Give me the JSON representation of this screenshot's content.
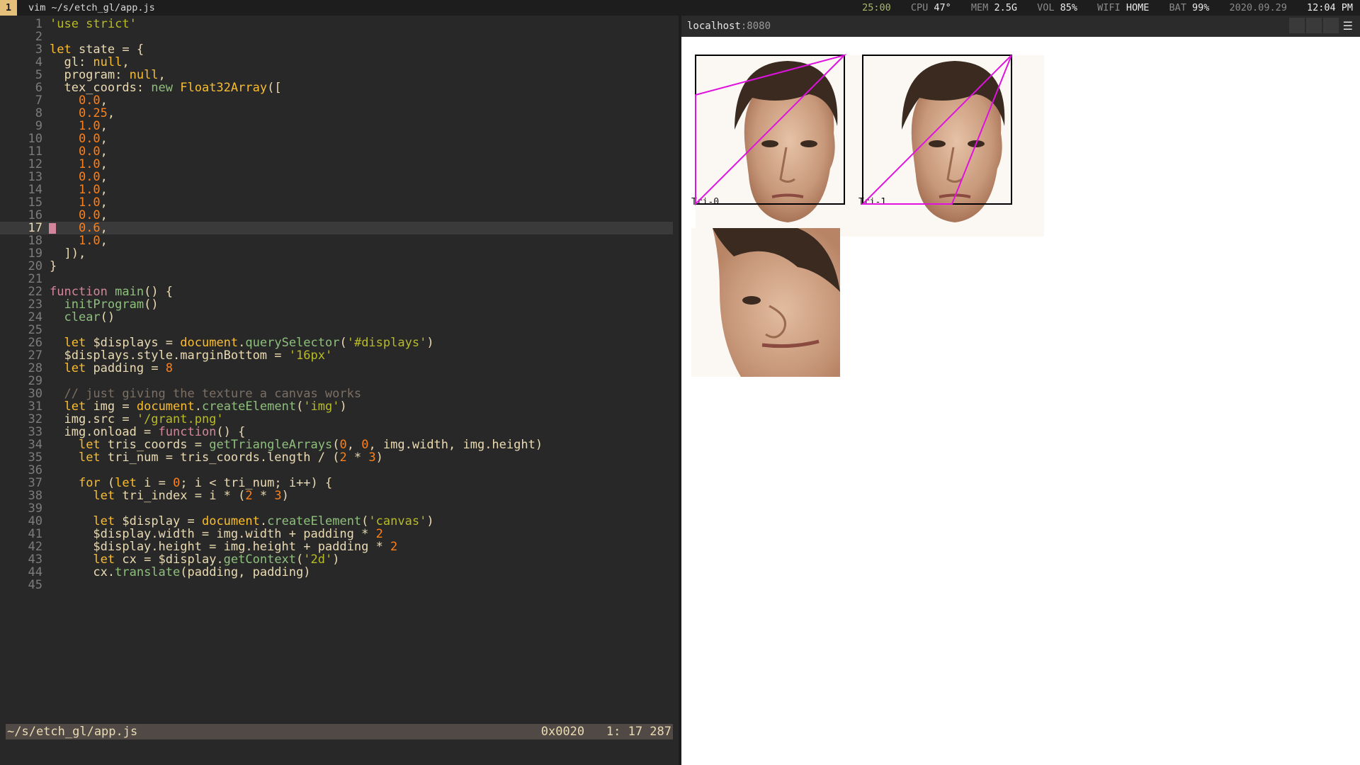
{
  "topbar": {
    "workspace": "1",
    "window_title": "vim ~/s/etch_gl/app.js",
    "timer": "25:00",
    "cpu_label": "CPU",
    "cpu_value": "47°",
    "mem_label": "MEM",
    "mem_value": "2.5G",
    "vol_label": "VOL",
    "vol_value": "85%",
    "wifi_label": "WIFI",
    "wifi_value": "HOME",
    "bat_label": "BAT",
    "bat_value": "99%",
    "date": "2020.09.29",
    "time": "12:04 PM"
  },
  "editor": {
    "current_line": 17,
    "lines": [
      {
        "n": "1",
        "tokens": [
          [
            "s",
            "'use strict'"
          ]
        ]
      },
      {
        "n": "2",
        "tokens": []
      },
      {
        "n": "3",
        "tokens": [
          [
            "k",
            "let"
          ],
          [
            "p",
            " state = {"
          ]
        ]
      },
      {
        "n": "4",
        "tokens": [
          [
            "p",
            "  gl: "
          ],
          [
            "l",
            "null"
          ],
          [
            "p",
            ","
          ]
        ]
      },
      {
        "n": "5",
        "tokens": [
          [
            "p",
            "  program: "
          ],
          [
            "l",
            "null"
          ],
          [
            "p",
            ","
          ]
        ]
      },
      {
        "n": "6",
        "tokens": [
          [
            "p",
            "  tex_coords: "
          ],
          [
            "f",
            "new "
          ],
          [
            "k",
            "Float32Array"
          ],
          [
            "p",
            "(["
          ]
        ]
      },
      {
        "n": "7",
        "tokens": [
          [
            "p",
            "    "
          ],
          [
            "n",
            "0.0"
          ],
          [
            "p",
            ","
          ]
        ]
      },
      {
        "n": "8",
        "tokens": [
          [
            "p",
            "    "
          ],
          [
            "n",
            "0.25"
          ],
          [
            "p",
            ","
          ]
        ]
      },
      {
        "n": "9",
        "tokens": [
          [
            "p",
            "    "
          ],
          [
            "n",
            "1.0"
          ],
          [
            "p",
            ","
          ]
        ]
      },
      {
        "n": "10",
        "tokens": [
          [
            "p",
            "    "
          ],
          [
            "n",
            "0.0"
          ],
          [
            "p",
            ","
          ]
        ]
      },
      {
        "n": "11",
        "tokens": [
          [
            "p",
            "    "
          ],
          [
            "n",
            "0.0"
          ],
          [
            "p",
            ","
          ]
        ]
      },
      {
        "n": "12",
        "tokens": [
          [
            "p",
            "    "
          ],
          [
            "n",
            "1.0"
          ],
          [
            "p",
            ","
          ]
        ]
      },
      {
        "n": "13",
        "tokens": [
          [
            "p",
            "    "
          ],
          [
            "n",
            "0.0"
          ],
          [
            "p",
            ","
          ]
        ]
      },
      {
        "n": "14",
        "tokens": [
          [
            "p",
            "    "
          ],
          [
            "n",
            "1.0"
          ],
          [
            "p",
            ","
          ]
        ]
      },
      {
        "n": "15",
        "tokens": [
          [
            "p",
            "    "
          ],
          [
            "n",
            "1.0"
          ],
          [
            "p",
            ","
          ]
        ]
      },
      {
        "n": "16",
        "tokens": [
          [
            "p",
            "    "
          ],
          [
            "n",
            "0.0"
          ],
          [
            "p",
            ","
          ]
        ]
      },
      {
        "n": "17",
        "tokens": [
          [
            "p",
            "    "
          ],
          [
            "n",
            "0.6"
          ],
          [
            "p",
            ","
          ]
        ]
      },
      {
        "n": "18",
        "tokens": [
          [
            "p",
            "    "
          ],
          [
            "n",
            "1.0"
          ],
          [
            "p",
            ","
          ]
        ]
      },
      {
        "n": "19",
        "tokens": [
          [
            "p",
            "  ]),"
          ]
        ]
      },
      {
        "n": "20",
        "tokens": [
          [
            "p",
            "}"
          ]
        ]
      },
      {
        "n": "21",
        "tokens": []
      },
      {
        "n": "22",
        "tokens": [
          [
            "m",
            "function "
          ],
          [
            "f",
            "main"
          ],
          [
            "p",
            "() {"
          ]
        ]
      },
      {
        "n": "23",
        "tokens": [
          [
            "p",
            "  "
          ],
          [
            "f",
            "initProgram"
          ],
          [
            "p",
            "()"
          ]
        ]
      },
      {
        "n": "24",
        "tokens": [
          [
            "p",
            "  "
          ],
          [
            "f",
            "clear"
          ],
          [
            "p",
            "()"
          ]
        ]
      },
      {
        "n": "25",
        "tokens": []
      },
      {
        "n": "26",
        "tokens": [
          [
            "p",
            "  "
          ],
          [
            "k",
            "let"
          ],
          [
            "p",
            " $displays = "
          ],
          [
            "k",
            "document"
          ],
          [
            "p",
            "."
          ],
          [
            "f",
            "querySelector"
          ],
          [
            "p",
            "("
          ],
          [
            "s",
            "'#displays'"
          ],
          [
            "p",
            ")"
          ]
        ]
      },
      {
        "n": "27",
        "tokens": [
          [
            "p",
            "  $displays.style.marginBottom = "
          ],
          [
            "s",
            "'16px'"
          ]
        ]
      },
      {
        "n": "28",
        "tokens": [
          [
            "p",
            "  "
          ],
          [
            "k",
            "let"
          ],
          [
            "p",
            " padding = "
          ],
          [
            "n",
            "8"
          ]
        ]
      },
      {
        "n": "29",
        "tokens": []
      },
      {
        "n": "30",
        "tokens": [
          [
            "c",
            "  // just giving the texture a canvas works"
          ]
        ]
      },
      {
        "n": "31",
        "tokens": [
          [
            "p",
            "  "
          ],
          [
            "k",
            "let"
          ],
          [
            "p",
            " img = "
          ],
          [
            "k",
            "document"
          ],
          [
            "p",
            "."
          ],
          [
            "f",
            "createElement"
          ],
          [
            "p",
            "("
          ],
          [
            "s",
            "'img'"
          ],
          [
            "p",
            ")"
          ]
        ]
      },
      {
        "n": "32",
        "tokens": [
          [
            "p",
            "  img.src = "
          ],
          [
            "s",
            "'/grant.png'"
          ]
        ]
      },
      {
        "n": "33",
        "tokens": [
          [
            "p",
            "  img.onload = "
          ],
          [
            "m",
            "function"
          ],
          [
            "p",
            "() {"
          ]
        ]
      },
      {
        "n": "34",
        "tokens": [
          [
            "p",
            "    "
          ],
          [
            "k",
            "let"
          ],
          [
            "p",
            " tris_coords = "
          ],
          [
            "f",
            "getTriangleArrays"
          ],
          [
            "p",
            "("
          ],
          [
            "n",
            "0"
          ],
          [
            "p",
            ", "
          ],
          [
            "n",
            "0"
          ],
          [
            "p",
            ", img.width, img.height)"
          ]
        ]
      },
      {
        "n": "35",
        "tokens": [
          [
            "p",
            "    "
          ],
          [
            "k",
            "let"
          ],
          [
            "p",
            " tri_num = tris_coords.length / ("
          ],
          [
            "n",
            "2"
          ],
          [
            "p",
            " * "
          ],
          [
            "n",
            "3"
          ],
          [
            "p",
            ")"
          ]
        ]
      },
      {
        "n": "36",
        "tokens": []
      },
      {
        "n": "37",
        "tokens": [
          [
            "p",
            "    "
          ],
          [
            "k",
            "for"
          ],
          [
            "p",
            " ("
          ],
          [
            "k",
            "let"
          ],
          [
            "p",
            " i = "
          ],
          [
            "n",
            "0"
          ],
          [
            "p",
            "; i < tri_num; i++) {"
          ]
        ]
      },
      {
        "n": "38",
        "tokens": [
          [
            "p",
            "      "
          ],
          [
            "k",
            "let"
          ],
          [
            "p",
            " tri_index = i * ("
          ],
          [
            "n",
            "2"
          ],
          [
            "p",
            " * "
          ],
          [
            "n",
            "3"
          ],
          [
            "p",
            ")"
          ]
        ]
      },
      {
        "n": "39",
        "tokens": []
      },
      {
        "n": "40",
        "tokens": [
          [
            "p",
            "      "
          ],
          [
            "k",
            "let"
          ],
          [
            "p",
            " $display = "
          ],
          [
            "k",
            "document"
          ],
          [
            "p",
            "."
          ],
          [
            "f",
            "createElement"
          ],
          [
            "p",
            "("
          ],
          [
            "s",
            "'canvas'"
          ],
          [
            "p",
            ")"
          ]
        ]
      },
      {
        "n": "41",
        "tokens": [
          [
            "p",
            "      $display.width = img.width + padding * "
          ],
          [
            "n",
            "2"
          ]
        ]
      },
      {
        "n": "42",
        "tokens": [
          [
            "p",
            "      $display.height = img.height + padding * "
          ],
          [
            "n",
            "2"
          ]
        ]
      },
      {
        "n": "43",
        "tokens": [
          [
            "p",
            "      "
          ],
          [
            "k",
            "let"
          ],
          [
            "p",
            " cx = $display."
          ],
          [
            "f",
            "getContext"
          ],
          [
            "p",
            "("
          ],
          [
            "s",
            "'2d'"
          ],
          [
            "p",
            ")"
          ]
        ]
      },
      {
        "n": "44",
        "tokens": [
          [
            "p",
            "      cx."
          ],
          [
            "f",
            "translate"
          ],
          [
            "p",
            "(padding, padding)"
          ]
        ]
      },
      {
        "n": "45",
        "tokens": []
      }
    ]
  },
  "statusline": {
    "path": "~/s/etch_gl/app.js",
    "hex": "0x0020",
    "position": "1: 17 287"
  },
  "browser": {
    "url_host": "localhost",
    "url_port": ":8080",
    "menu_icon": "hamburger-icon",
    "canvases": [
      {
        "caption": "Tri-0"
      },
      {
        "caption": "Tri-1"
      },
      {
        "caption": ""
      }
    ],
    "overlay_color": "#e012e0"
  },
  "colors": {
    "editor_bg": "#282828",
    "workspace_accent": "#e5c07b",
    "cursor": "#d3869b"
  }
}
